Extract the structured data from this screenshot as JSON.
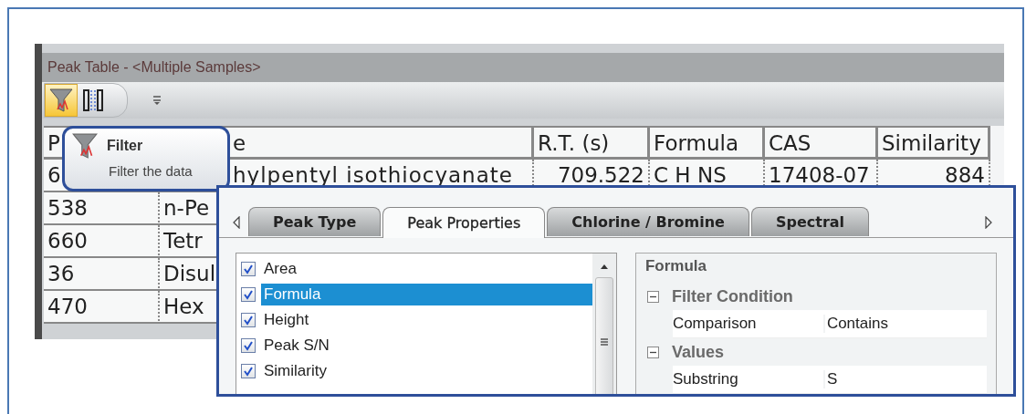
{
  "window": {
    "title": "Peak Table - <Multiple Samples>"
  },
  "toolbar": {
    "buttons": [
      {
        "kind": "filter",
        "selected": true
      },
      {
        "kind": "columns",
        "selected": false
      }
    ]
  },
  "table": {
    "columns": [
      "P",
      "e",
      "R.T. (s)",
      "Formula",
      "CAS",
      "Similarity"
    ],
    "rows": [
      [
        "6",
        "hylpentyl isothiocyanate",
        "709.522",
        "C H NS",
        "17408-07",
        "884"
      ],
      [
        "538",
        "n-Pe"
      ],
      [
        "660",
        "Tetr"
      ],
      [
        "36",
        "Disul"
      ],
      [
        "470",
        "Hex"
      ]
    ]
  },
  "tooltip": {
    "title": "Filter",
    "description": "Filter the data"
  },
  "filter_panel": {
    "tabs": [
      {
        "label": "Peak Type",
        "selected": false
      },
      {
        "label": "Peak Properties",
        "selected": true
      },
      {
        "label": "Chlorine / Bromine",
        "selected": false
      },
      {
        "label": "Spectral",
        "selected": false
      }
    ],
    "properties_list": [
      {
        "label": "Area",
        "checked": true,
        "selected": false
      },
      {
        "label": "Formula",
        "checked": true,
        "selected": true
      },
      {
        "label": "Height",
        "checked": true,
        "selected": false
      },
      {
        "label": "Peak S/N",
        "checked": true,
        "selected": false
      },
      {
        "label": "Similarity",
        "checked": true,
        "selected": false
      }
    ],
    "property_grid": {
      "title": "Formula",
      "groups": [
        {
          "label": "Filter Condition",
          "expanded": true,
          "rows": [
            {
              "name": "Comparison",
              "value": "Contains"
            }
          ]
        },
        {
          "label": "Values",
          "expanded": true,
          "rows": [
            {
              "name": "Substring",
              "value": "S"
            }
          ]
        }
      ]
    }
  }
}
